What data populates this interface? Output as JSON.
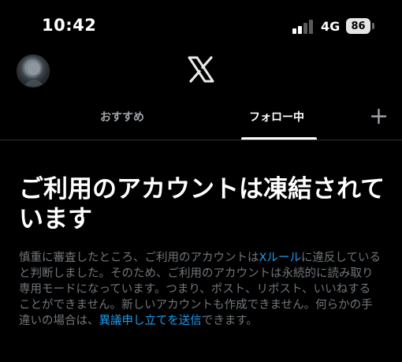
{
  "status_bar": {
    "time": "10:42",
    "network": "4G",
    "battery": "86"
  },
  "header": {
    "logo_icon": "x-logo-icon",
    "avatar": "user-avatar"
  },
  "tabs": [
    {
      "label": "おすすめ",
      "active": false
    },
    {
      "label": "フォロー中",
      "active": true
    }
  ],
  "add_tab_icon": "plus-icon",
  "notice": {
    "title": "ご利用のアカウントは凍結されています",
    "body_part1": "慎重に審査したところ、ご利用のアカウントは",
    "rules_link": "Xルール",
    "body_part2": "に違反していると判断しました。そのため、ご利用のアカウントは永続的に読み取り専用モードになっています。つまり、ポスト、リポスト、いいねすることができません。新しいアカウントも作成できません。何らかの手違いの場合は、",
    "appeal_link": "異議申し立てを送信",
    "body_part3": "できます。"
  },
  "colors": {
    "background": "#000000",
    "text_primary": "#ffffff",
    "text_secondary": "#71767b",
    "link": "#1d9bf0",
    "divider": "#2f3336"
  }
}
